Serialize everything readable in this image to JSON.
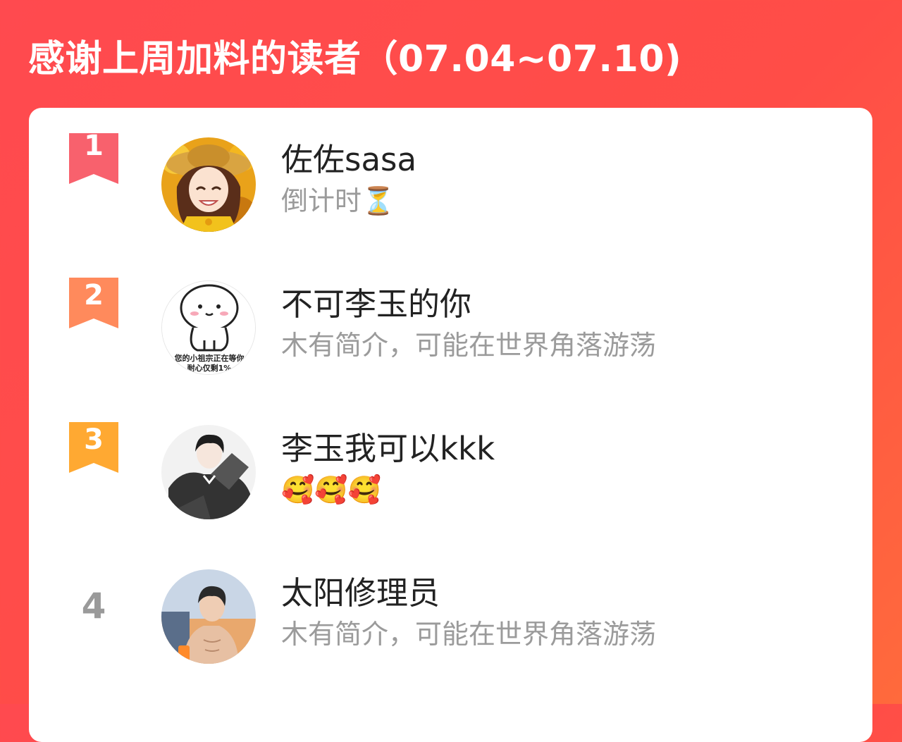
{
  "page": {
    "title": "感谢上周加料的读者（07.04~07.10)"
  },
  "colors": {
    "header_start": "#ff4a4f",
    "header_end": "#ff6a3c",
    "rank1": "#f8616d",
    "rank2": "#ff8a5c",
    "rank3": "#ffa932",
    "rank_plain": "#9a9a9a",
    "name_text": "#222222",
    "bio_text": "#9b9b9b"
  },
  "readers": [
    {
      "rank": "1",
      "name": "佐佐sasa",
      "bio": "倒计时",
      "bio_emoji": "⏳",
      "avatar_icon": "anime-girl-avatar"
    },
    {
      "rank": "2",
      "name": "不可李玉的你",
      "bio": "木有简介，可能在世界角落游荡",
      "avatar_icon": "cartoon-bun-avatar",
      "avatar_text_line1": "您的小祖宗正在等你",
      "avatar_text_line2": "耐心仅剩1%"
    },
    {
      "rank": "3",
      "name": "李玉我可以kkk",
      "bio_emojis": [
        "🥰",
        "🥰",
        "🥰"
      ],
      "avatar_icon": "anime-man-sketch-avatar"
    },
    {
      "rank": "4",
      "name": "太阳修理员",
      "bio": "木有简介，可能在世界角落游荡",
      "avatar_icon": "anime-man-sunset-avatar"
    }
  ]
}
